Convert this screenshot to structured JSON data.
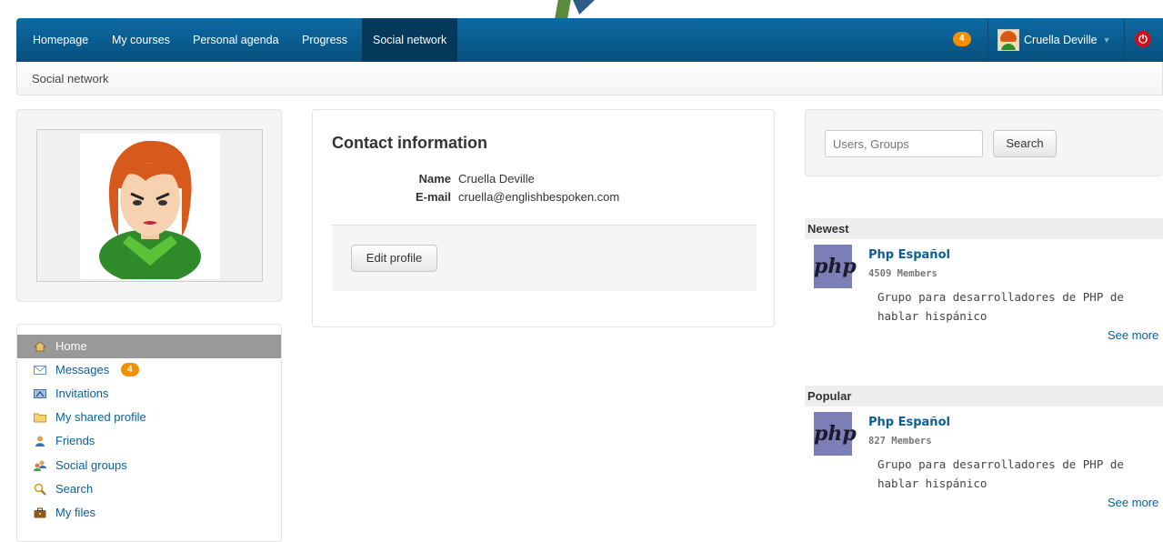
{
  "nav": {
    "items": [
      "Homepage",
      "My courses",
      "Personal agenda",
      "Progress",
      "Social network"
    ],
    "active_index": 4,
    "notification_count": "4",
    "user_name": "Cruella Deville"
  },
  "breadcrumb": "Social network",
  "sidebar": {
    "items": [
      {
        "label": "Home",
        "icon": "home-icon",
        "active": true
      },
      {
        "label": "Messages",
        "icon": "envelope-icon",
        "badge": "4"
      },
      {
        "label": "Invitations",
        "icon": "invitation-icon"
      },
      {
        "label": "My shared profile",
        "icon": "folder-icon"
      },
      {
        "label": "Friends",
        "icon": "user-icon"
      },
      {
        "label": "Social groups",
        "icon": "group-icon"
      },
      {
        "label": "Search",
        "icon": "search-icon"
      },
      {
        "label": "My files",
        "icon": "briefcase-icon"
      }
    ]
  },
  "contact": {
    "title": "Contact information",
    "name_label": "Name",
    "name_value": "Cruella Deville",
    "email_label": "E-mail",
    "email_value": "cruella@englishbespoken.com",
    "edit_button": "Edit profile"
  },
  "search": {
    "placeholder": "Users, Groups",
    "button": "Search"
  },
  "newest": {
    "title": "Newest",
    "group_name": "Php Español",
    "members": "4509 Members",
    "description": "Grupo para desarrolladores de PHP de hablar hispánico",
    "see_more": "See more",
    "logo_text": "php"
  },
  "popular": {
    "title": "Popular",
    "group_name": "Php Español",
    "members": "827 Members",
    "description": "Grupo para desarrolladores de PHP de hablar hispánico",
    "see_more": "See more",
    "logo_text": "php"
  }
}
